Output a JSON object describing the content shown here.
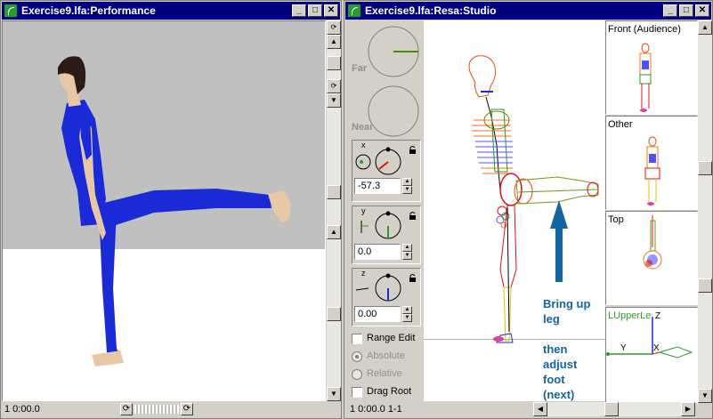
{
  "left_window": {
    "title": "Exercise9.lfa:Performance",
    "status_time": "1 0:00.0"
  },
  "right_window": {
    "title": "Exercise9.lfa:Resa:Studio",
    "status_time": "1 0:00.0 1-1"
  },
  "dials": {
    "far_label": "Far",
    "near_label": "Near",
    "x_axis": "x",
    "y_axis": "y",
    "z_axis": "z",
    "x_value": "-57.3",
    "y_value": "0.0",
    "z_value": "0.00"
  },
  "options": {
    "range_edit": "Range Edit",
    "absolute": "Absolute",
    "relative": "Relative",
    "drag_root": "Drag Root"
  },
  "annotation": {
    "line1": "Bring up",
    "line2": "leg",
    "line3": "then",
    "line4": "adjust",
    "line5": "foot",
    "line6": "(next)"
  },
  "view_panels": {
    "front": "Front (Audience)",
    "other": "Other",
    "top": "Top",
    "joint": "LUpperLe",
    "axis_z": "Z",
    "axis_y": "Y",
    "axis_x": "X"
  },
  "colors": {
    "titlebar": "#000080",
    "annotation_blue": "#1464a0",
    "body_suit": "#1a2ad6"
  }
}
